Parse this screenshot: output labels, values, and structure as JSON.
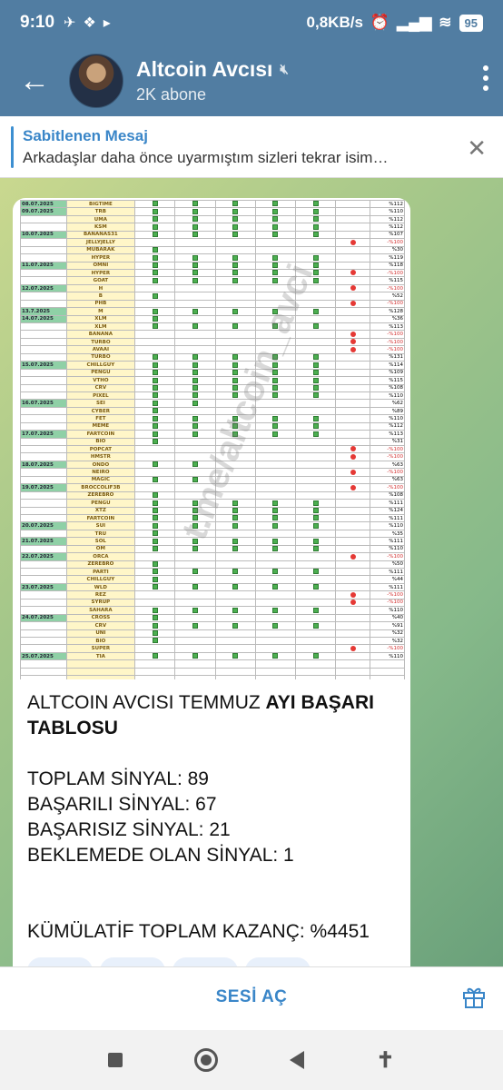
{
  "status": {
    "time": "9:10",
    "net_speed": "0,8KB/s",
    "battery": "95"
  },
  "header": {
    "title": "Altcoin Avcısı",
    "subscribers": "2K abone"
  },
  "pinned": {
    "title": "Sabitlenen Mesaj",
    "text": "Arkadaşlar daha önce uyarmıştım sizleri tekrar isim…"
  },
  "colors": {
    "header_bg": "#517da2",
    "accent": "#3a86c8",
    "success": "#4caf50",
    "fail": "#e53935"
  },
  "table": {
    "watermark": "t.me/altcoin_avci",
    "rows": [
      {
        "date": "08.07.2025",
        "coin": "BIGTIME",
        "checks": 5,
        "fail": false,
        "pct": "%112"
      },
      {
        "date": "09.07.2025",
        "coin": "TRB",
        "checks": 5,
        "fail": false,
        "pct": "%110"
      },
      {
        "date": "",
        "coin": "UMA",
        "checks": 5,
        "fail": false,
        "pct": "%112"
      },
      {
        "date": "",
        "coin": "KSM",
        "checks": 5,
        "fail": false,
        "pct": "%112"
      },
      {
        "date": "10.07.2025",
        "coin": "BANANAS31",
        "checks": 5,
        "fail": false,
        "pct": "%107"
      },
      {
        "date": "",
        "coin": "JELLYJELLY",
        "checks": 0,
        "fail": true,
        "pct": "-%100"
      },
      {
        "date": "",
        "coin": "MUBARAK",
        "checks": 1,
        "fail": false,
        "pct": "%30"
      },
      {
        "date": "",
        "coin": "HYPER",
        "checks": 5,
        "fail": false,
        "pct": "%119"
      },
      {
        "date": "11.07.2025",
        "coin": "OMNI",
        "checks": 5,
        "fail": false,
        "pct": "%118"
      },
      {
        "date": "",
        "coin": "HYPER",
        "checks": 5,
        "fail": true,
        "pct": "-%100"
      },
      {
        "date": "",
        "coin": "GOAT",
        "checks": 5,
        "fail": false,
        "pct": "%115"
      },
      {
        "date": "12.07.2025",
        "coin": "H",
        "checks": 0,
        "fail": true,
        "pct": "-%100"
      },
      {
        "date": "",
        "coin": "B",
        "checks": 1,
        "fail": false,
        "pct": "%52"
      },
      {
        "date": "",
        "coin": "PHB",
        "checks": 0,
        "fail": true,
        "pct": "-%100"
      },
      {
        "date": "13.7.2025",
        "coin": "M",
        "checks": 5,
        "fail": false,
        "pct": "%128"
      },
      {
        "date": "14.07.2025",
        "coin": "XLM",
        "checks": 1,
        "fail": false,
        "pct": "%36"
      },
      {
        "date": "",
        "coin": "XLM",
        "checks": 5,
        "fail": false,
        "pct": "%113"
      },
      {
        "date": "",
        "coin": "BANANA",
        "checks": 0,
        "fail": true,
        "pct": "-%100"
      },
      {
        "date": "",
        "coin": "TURBO",
        "checks": 0,
        "fail": true,
        "pct": "-%100"
      },
      {
        "date": "",
        "coin": "AVAAI",
        "checks": 0,
        "fail": true,
        "pct": "-%100"
      },
      {
        "date": "",
        "coin": "TURBO",
        "checks": 5,
        "fail": false,
        "pct": "%131"
      },
      {
        "date": "15.07.2025",
        "coin": "CHILLGUY",
        "checks": 5,
        "fail": false,
        "pct": "%114"
      },
      {
        "date": "",
        "coin": "PENGU",
        "checks": 5,
        "fail": false,
        "pct": "%109"
      },
      {
        "date": "",
        "coin": "VTHO",
        "checks": 5,
        "fail": false,
        "pct": "%115"
      },
      {
        "date": "",
        "coin": "CRV",
        "checks": 5,
        "fail": false,
        "pct": "%108"
      },
      {
        "date": "",
        "coin": "PIXEL",
        "checks": 5,
        "fail": false,
        "pct": "%110"
      },
      {
        "date": "16.07.2025",
        "coin": "SEI",
        "checks": 2,
        "fail": false,
        "pct": "%62"
      },
      {
        "date": "",
        "coin": "CYBER",
        "checks": 1,
        "fail": false,
        "pct": "%89"
      },
      {
        "date": "",
        "coin": "FET",
        "checks": 5,
        "fail": false,
        "pct": "%110"
      },
      {
        "date": "",
        "coin": "MEME",
        "checks": 5,
        "fail": false,
        "pct": "%112"
      },
      {
        "date": "17.07.2025",
        "coin": "FARTCOIN",
        "checks": 5,
        "fail": false,
        "pct": "%113"
      },
      {
        "date": "",
        "coin": "BIO",
        "checks": 1,
        "fail": false,
        "pct": "%31"
      },
      {
        "date": "",
        "coin": "POPCAT",
        "checks": 0,
        "fail": true,
        "pct": "-%100"
      },
      {
        "date": "",
        "coin": "HMSTR",
        "checks": 0,
        "fail": true,
        "pct": "-%100"
      },
      {
        "date": "18.07.2025",
        "coin": "ONDO",
        "checks": 2,
        "fail": false,
        "pct": "%63"
      },
      {
        "date": "",
        "coin": "NEIRO",
        "checks": 0,
        "fail": true,
        "pct": "-%100"
      },
      {
        "date": "",
        "coin": "MAGIC",
        "checks": 2,
        "fail": false,
        "pct": "%63"
      },
      {
        "date": "19.07.2025",
        "coin": "BROCCOLIF3B",
        "checks": 0,
        "fail": true,
        "pct": "-%100"
      },
      {
        "date": "",
        "coin": "ZEREBRO",
        "checks": 1,
        "fail": false,
        "pct": "%108"
      },
      {
        "date": "",
        "coin": "PENGU",
        "checks": 5,
        "fail": false,
        "pct": "%111"
      },
      {
        "date": "",
        "coin": "XTZ",
        "checks": 5,
        "fail": false,
        "pct": "%124"
      },
      {
        "date": "",
        "coin": "FARTCOIN",
        "checks": 5,
        "fail": false,
        "pct": "%111"
      },
      {
        "date": "20.07.2025",
        "coin": "SUI",
        "checks": 5,
        "fail": false,
        "pct": "%110"
      },
      {
        "date": "",
        "coin": "TRU",
        "checks": 1,
        "fail": false,
        "pct": "%35"
      },
      {
        "date": "21.07.2025",
        "coin": "SOL",
        "checks": 5,
        "fail": false,
        "pct": "%111"
      },
      {
        "date": "",
        "coin": "OM",
        "checks": 5,
        "fail": false,
        "pct": "%110"
      },
      {
        "date": "22.07.2025",
        "coin": "ORCA",
        "checks": 0,
        "fail": true,
        "pct": "-%100"
      },
      {
        "date": "",
        "coin": "ZEREBRO",
        "checks": 1,
        "fail": false,
        "pct": "%50"
      },
      {
        "date": "",
        "coin": "PARTI",
        "checks": 5,
        "fail": false,
        "pct": "%111"
      },
      {
        "date": "",
        "coin": "CHILLGUY",
        "checks": 1,
        "fail": false,
        "pct": "%44"
      },
      {
        "date": "23.07.2025",
        "coin": "WLD",
        "checks": 5,
        "fail": false,
        "pct": "%111"
      },
      {
        "date": "",
        "coin": "REZ",
        "checks": 0,
        "fail": true,
        "pct": "-%100"
      },
      {
        "date": "",
        "coin": "SYRUP",
        "checks": 0,
        "fail": true,
        "pct": "-%100"
      },
      {
        "date": "",
        "coin": "SAHARA",
        "checks": 5,
        "fail": false,
        "pct": "%110"
      },
      {
        "date": "24.07.2025",
        "coin": "CROSS",
        "checks": 1,
        "fail": false,
        "pct": "%40"
      },
      {
        "date": "",
        "coin": "CRV",
        "checks": 5,
        "fail": false,
        "pct": "%91"
      },
      {
        "date": "",
        "coin": "UNI",
        "checks": 1,
        "fail": false,
        "pct": "%32"
      },
      {
        "date": "",
        "coin": "BIO",
        "checks": 1,
        "fail": false,
        "pct": "%32"
      },
      {
        "date": "",
        "coin": "SUPER",
        "checks": 0,
        "fail": true,
        "pct": "-%100"
      },
      {
        "date": "25.07.2025",
        "coin": "TIA",
        "checks": 5,
        "fail": false,
        "pct": "%110"
      },
      {
        "date": "",
        "coin": "",
        "checks": 0,
        "fail": false,
        "pct": ""
      },
      {
        "date": "",
        "coin": "",
        "checks": 0,
        "fail": false,
        "pct": ""
      },
      {
        "date": "",
        "coin": "",
        "checks": 0,
        "fail": false,
        "pct": ""
      }
    ]
  },
  "message": {
    "line1_plain": "ALTCOIN AVCISI TEMMUZ ",
    "line1_bold": "AYI BAŞARI",
    "line2_bold": "TABLOSU",
    "total": "TOPLAM SİNYAL:  89",
    "success": "BAŞARILI SİNYAL: 67",
    "failed": "BAŞARISIZ SİNYAL: 21",
    "pending": "BEKLEMEDE OLAN SİNYAL: 1",
    "cumulative": "KÜMÜLATİF TOPLAM KAZANÇ: %4451"
  },
  "bottom": {
    "unmute_label": "SESİ AÇ"
  }
}
